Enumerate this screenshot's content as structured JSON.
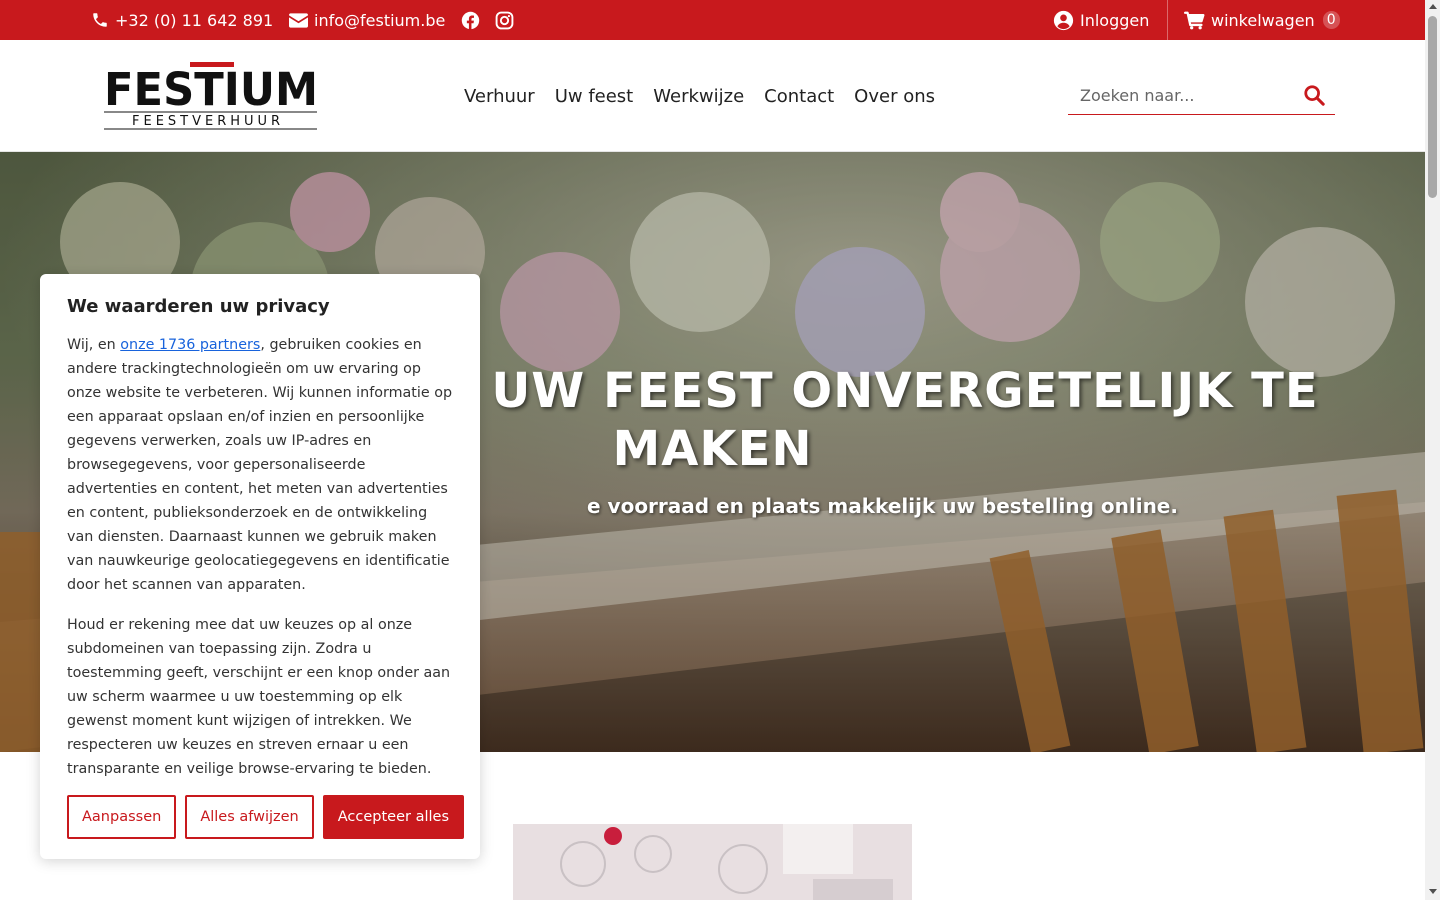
{
  "topbar": {
    "phone": "+32 (0) 11 642 891",
    "email": "info@festium.be",
    "login": "Inloggen",
    "cart_label": "winkelwagen",
    "cart_count": "0"
  },
  "logo": {
    "brand": "FESTIUM",
    "tagline": "FEESTVERHUUR"
  },
  "nav": {
    "items": [
      "Verhuur",
      "Uw feest",
      "Werkwijze",
      "Contact",
      "Over ons"
    ]
  },
  "search": {
    "placeholder": "Zoeken naar..."
  },
  "hero": {
    "title_line1": "UW FEEST ONVERGETELIJK TE",
    "title_line2": "MAKEN",
    "subtitle": "e voorraad en plaats makkelijk uw bestelling online."
  },
  "cookie": {
    "title": "We waarderen uw privacy",
    "p1_before": "Wij, en ",
    "p1_link": "onze 1736 partners",
    "p1_after": ", gebruiken cookies en andere trackingtechnologieën om uw ervaring op onze website te verbeteren. Wij kunnen informatie op een apparaat opslaan en/of inzien en persoonlijke gegevens verwerken, zoals uw IP-adres en browsegegevens, voor gepersonaliseerde advertenties en content, het meten van advertenties en content, publieksonderzoek en de ontwikkeling van diensten. Daarnaast kunnen we gebruik maken van nauwkeurige geolocatiegegevens en identificatie door het scannen van apparaten.",
    "p2": "Houd er rekening mee dat uw keuzes op al onze subdomeinen van toepassing zijn. Zodra u toestemming geeft, verschijnt er een knop onder aan uw scherm waarmee u uw toestemming op elk gewenst moment kunt wijzigen of intrekken. We respecteren uw keuzes en streven ernaar u een transparante en veilige browse-ervaring te bieden.",
    "btn_customize": "Aanpassen",
    "btn_reject": "Alles afwijzen",
    "btn_accept": "Accepteer alles"
  },
  "colors": {
    "brand_red": "#c8191d",
    "link_blue": "#1863dc"
  },
  "icons": [
    "phone-icon",
    "envelope-icon",
    "facebook-icon",
    "instagram-icon",
    "user-circle-icon",
    "cart-icon",
    "search-icon"
  ]
}
